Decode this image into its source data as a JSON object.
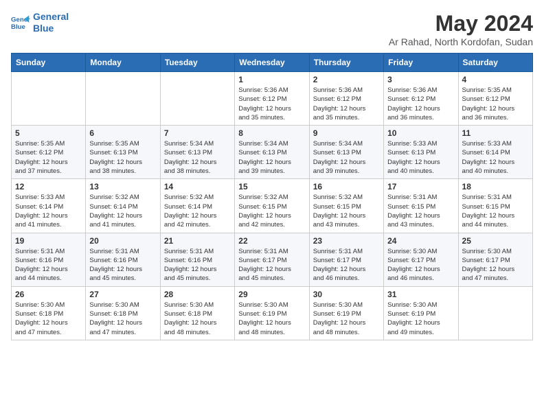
{
  "logo": {
    "line1": "General",
    "line2": "Blue"
  },
  "title": "May 2024",
  "location": "Ar Rahad, North Kordofan, Sudan",
  "days_header": [
    "Sunday",
    "Monday",
    "Tuesday",
    "Wednesday",
    "Thursday",
    "Friday",
    "Saturday"
  ],
  "weeks": [
    [
      {
        "num": "",
        "info": ""
      },
      {
        "num": "",
        "info": ""
      },
      {
        "num": "",
        "info": ""
      },
      {
        "num": "1",
        "info": "Sunrise: 5:36 AM\nSunset: 6:12 PM\nDaylight: 12 hours\nand 35 minutes."
      },
      {
        "num": "2",
        "info": "Sunrise: 5:36 AM\nSunset: 6:12 PM\nDaylight: 12 hours\nand 35 minutes."
      },
      {
        "num": "3",
        "info": "Sunrise: 5:36 AM\nSunset: 6:12 PM\nDaylight: 12 hours\nand 36 minutes."
      },
      {
        "num": "4",
        "info": "Sunrise: 5:35 AM\nSunset: 6:12 PM\nDaylight: 12 hours\nand 36 minutes."
      }
    ],
    [
      {
        "num": "5",
        "info": "Sunrise: 5:35 AM\nSunset: 6:12 PM\nDaylight: 12 hours\nand 37 minutes."
      },
      {
        "num": "6",
        "info": "Sunrise: 5:35 AM\nSunset: 6:13 PM\nDaylight: 12 hours\nand 38 minutes."
      },
      {
        "num": "7",
        "info": "Sunrise: 5:34 AM\nSunset: 6:13 PM\nDaylight: 12 hours\nand 38 minutes."
      },
      {
        "num": "8",
        "info": "Sunrise: 5:34 AM\nSunset: 6:13 PM\nDaylight: 12 hours\nand 39 minutes."
      },
      {
        "num": "9",
        "info": "Sunrise: 5:34 AM\nSunset: 6:13 PM\nDaylight: 12 hours\nand 39 minutes."
      },
      {
        "num": "10",
        "info": "Sunrise: 5:33 AM\nSunset: 6:13 PM\nDaylight: 12 hours\nand 40 minutes."
      },
      {
        "num": "11",
        "info": "Sunrise: 5:33 AM\nSunset: 6:14 PM\nDaylight: 12 hours\nand 40 minutes."
      }
    ],
    [
      {
        "num": "12",
        "info": "Sunrise: 5:33 AM\nSunset: 6:14 PM\nDaylight: 12 hours\nand 41 minutes."
      },
      {
        "num": "13",
        "info": "Sunrise: 5:32 AM\nSunset: 6:14 PM\nDaylight: 12 hours\nand 41 minutes."
      },
      {
        "num": "14",
        "info": "Sunrise: 5:32 AM\nSunset: 6:14 PM\nDaylight: 12 hours\nand 42 minutes."
      },
      {
        "num": "15",
        "info": "Sunrise: 5:32 AM\nSunset: 6:15 PM\nDaylight: 12 hours\nand 42 minutes."
      },
      {
        "num": "16",
        "info": "Sunrise: 5:32 AM\nSunset: 6:15 PM\nDaylight: 12 hours\nand 43 minutes."
      },
      {
        "num": "17",
        "info": "Sunrise: 5:31 AM\nSunset: 6:15 PM\nDaylight: 12 hours\nand 43 minutes."
      },
      {
        "num": "18",
        "info": "Sunrise: 5:31 AM\nSunset: 6:15 PM\nDaylight: 12 hours\nand 44 minutes."
      }
    ],
    [
      {
        "num": "19",
        "info": "Sunrise: 5:31 AM\nSunset: 6:16 PM\nDaylight: 12 hours\nand 44 minutes."
      },
      {
        "num": "20",
        "info": "Sunrise: 5:31 AM\nSunset: 6:16 PM\nDaylight: 12 hours\nand 45 minutes."
      },
      {
        "num": "21",
        "info": "Sunrise: 5:31 AM\nSunset: 6:16 PM\nDaylight: 12 hours\nand 45 minutes."
      },
      {
        "num": "22",
        "info": "Sunrise: 5:31 AM\nSunset: 6:17 PM\nDaylight: 12 hours\nand 45 minutes."
      },
      {
        "num": "23",
        "info": "Sunrise: 5:31 AM\nSunset: 6:17 PM\nDaylight: 12 hours\nand 46 minutes."
      },
      {
        "num": "24",
        "info": "Sunrise: 5:30 AM\nSunset: 6:17 PM\nDaylight: 12 hours\nand 46 minutes."
      },
      {
        "num": "25",
        "info": "Sunrise: 5:30 AM\nSunset: 6:17 PM\nDaylight: 12 hours\nand 47 minutes."
      }
    ],
    [
      {
        "num": "26",
        "info": "Sunrise: 5:30 AM\nSunset: 6:18 PM\nDaylight: 12 hours\nand 47 minutes."
      },
      {
        "num": "27",
        "info": "Sunrise: 5:30 AM\nSunset: 6:18 PM\nDaylight: 12 hours\nand 47 minutes."
      },
      {
        "num": "28",
        "info": "Sunrise: 5:30 AM\nSunset: 6:18 PM\nDaylight: 12 hours\nand 48 minutes."
      },
      {
        "num": "29",
        "info": "Sunrise: 5:30 AM\nSunset: 6:19 PM\nDaylight: 12 hours\nand 48 minutes."
      },
      {
        "num": "30",
        "info": "Sunrise: 5:30 AM\nSunset: 6:19 PM\nDaylight: 12 hours\nand 48 minutes."
      },
      {
        "num": "31",
        "info": "Sunrise: 5:30 AM\nSunset: 6:19 PM\nDaylight: 12 hours\nand 49 minutes."
      },
      {
        "num": "",
        "info": ""
      }
    ]
  ]
}
